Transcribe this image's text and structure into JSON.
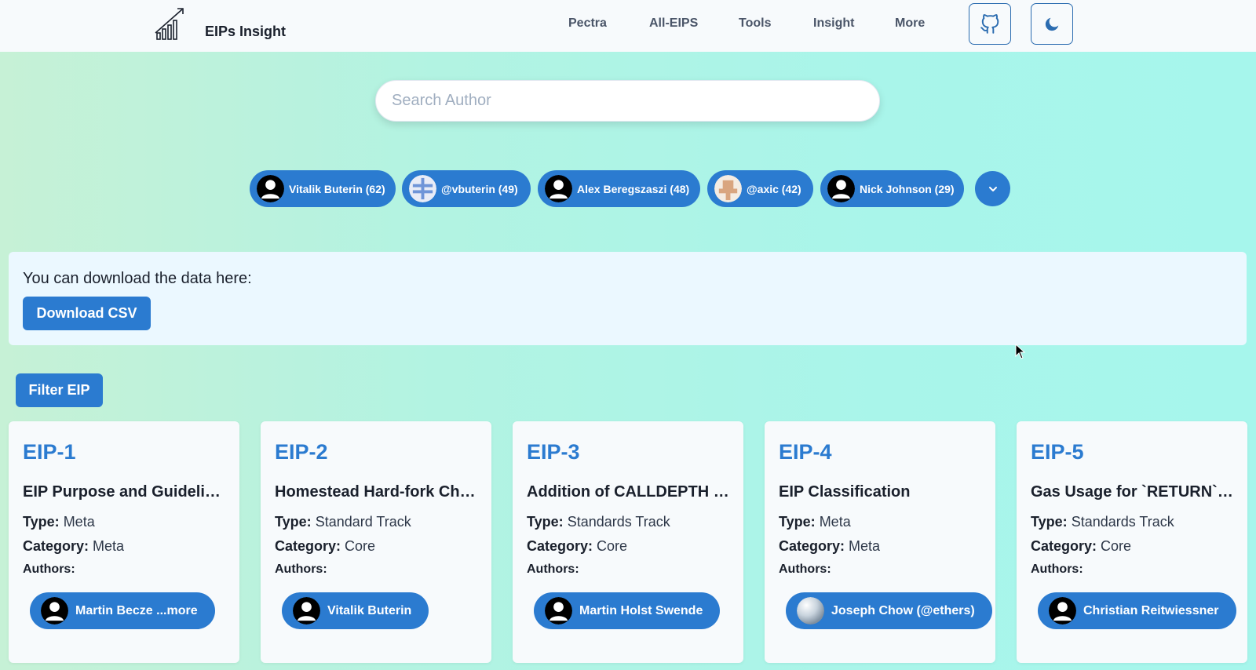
{
  "nav": {
    "brand": "EIPs Insight",
    "links": [
      "Pectra",
      "All-EIPS",
      "Tools",
      "Insight",
      "More"
    ],
    "github_icon": "github-icon",
    "theme_icon": "moon-icon"
  },
  "search": {
    "placeholder": "Search Author",
    "value": ""
  },
  "authors": [
    {
      "label": "Vitalik Buterin (62)",
      "avatar": "default-user"
    },
    {
      "label": "@vbuterin (49)",
      "avatar": "identicon-blue"
    },
    {
      "label": "Alex Beregszaszi (48)",
      "avatar": "default-user"
    },
    {
      "label": "@axic (42)",
      "avatar": "identicon-tan"
    },
    {
      "label": "Nick Johnson (29)",
      "avatar": "default-user"
    }
  ],
  "download": {
    "text": "You can download the data here:",
    "button": "Download CSV"
  },
  "filter_button": "Filter EIP",
  "labels": {
    "type": "Type:",
    "category": "Category:",
    "authors": "Authors:"
  },
  "eips": [
    {
      "id": "EIP-1",
      "title": "EIP Purpose and Guidelines",
      "type": "Meta",
      "category": "Meta",
      "author": "Martin Becze ...more",
      "avatar": "default-user"
    },
    {
      "id": "EIP-2",
      "title": "Homestead Hard-fork Changes",
      "type": "Standard Track",
      "category": "Core",
      "author": "Vitalik Buterin",
      "avatar": "default-user"
    },
    {
      "id": "EIP-3",
      "title": "Addition of CALLDEPTH opcode",
      "type": "Standards Track",
      "category": "Core",
      "author": "Martin Holst Swende",
      "avatar": "default-user"
    },
    {
      "id": "EIP-4",
      "title": "EIP Classification",
      "type": "Meta",
      "category": "Meta",
      "author": "Joseph Chow (@ethers)",
      "avatar": "sphere"
    },
    {
      "id": "EIP-5",
      "title": "Gas Usage for `RETURN` and `CALL*`",
      "type": "Standards Track",
      "category": "Core",
      "author": "Christian Reitwiessner",
      "avatar": "default-user"
    }
  ],
  "colors": {
    "accent": "#2b7bd0",
    "navbar": "#f7fafc",
    "panel": "#ebf8ff"
  }
}
